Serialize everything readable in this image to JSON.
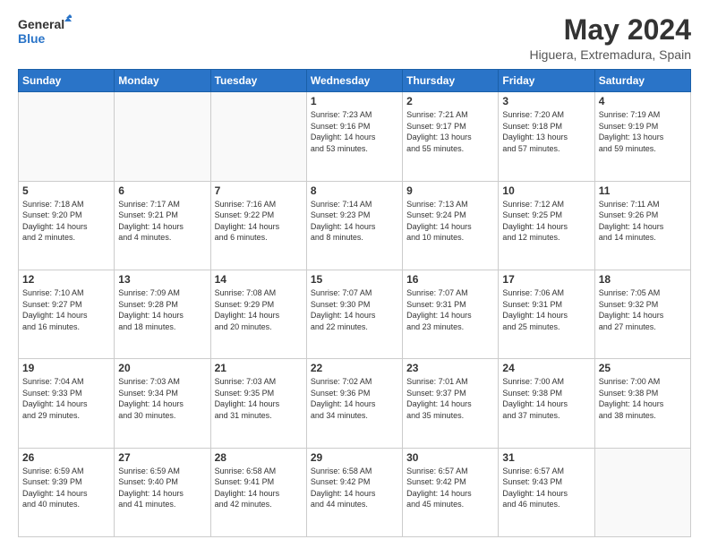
{
  "logo": {
    "line1": "General",
    "line2": "Blue"
  },
  "title": "May 2024",
  "subtitle": "Higuera, Extremadura, Spain",
  "days_of_week": [
    "Sunday",
    "Monday",
    "Tuesday",
    "Wednesday",
    "Thursday",
    "Friday",
    "Saturday"
  ],
  "weeks": [
    [
      {
        "day": "",
        "info": []
      },
      {
        "day": "",
        "info": []
      },
      {
        "day": "",
        "info": []
      },
      {
        "day": "1",
        "info": [
          "Sunrise: 7:23 AM",
          "Sunset: 9:16 PM",
          "Daylight: 14 hours",
          "and 53 minutes."
        ]
      },
      {
        "day": "2",
        "info": [
          "Sunrise: 7:21 AM",
          "Sunset: 9:17 PM",
          "Daylight: 13 hours",
          "and 55 minutes."
        ]
      },
      {
        "day": "3",
        "info": [
          "Sunrise: 7:20 AM",
          "Sunset: 9:18 PM",
          "Daylight: 13 hours",
          "and 57 minutes."
        ]
      },
      {
        "day": "4",
        "info": [
          "Sunrise: 7:19 AM",
          "Sunset: 9:19 PM",
          "Daylight: 13 hours",
          "and 59 minutes."
        ]
      }
    ],
    [
      {
        "day": "5",
        "info": [
          "Sunrise: 7:18 AM",
          "Sunset: 9:20 PM",
          "Daylight: 14 hours",
          "and 2 minutes."
        ]
      },
      {
        "day": "6",
        "info": [
          "Sunrise: 7:17 AM",
          "Sunset: 9:21 PM",
          "Daylight: 14 hours",
          "and 4 minutes."
        ]
      },
      {
        "day": "7",
        "info": [
          "Sunrise: 7:16 AM",
          "Sunset: 9:22 PM",
          "Daylight: 14 hours",
          "and 6 minutes."
        ]
      },
      {
        "day": "8",
        "info": [
          "Sunrise: 7:14 AM",
          "Sunset: 9:23 PM",
          "Daylight: 14 hours",
          "and 8 minutes."
        ]
      },
      {
        "day": "9",
        "info": [
          "Sunrise: 7:13 AM",
          "Sunset: 9:24 PM",
          "Daylight: 14 hours",
          "and 10 minutes."
        ]
      },
      {
        "day": "10",
        "info": [
          "Sunrise: 7:12 AM",
          "Sunset: 9:25 PM",
          "Daylight: 14 hours",
          "and 12 minutes."
        ]
      },
      {
        "day": "11",
        "info": [
          "Sunrise: 7:11 AM",
          "Sunset: 9:26 PM",
          "Daylight: 14 hours",
          "and 14 minutes."
        ]
      }
    ],
    [
      {
        "day": "12",
        "info": [
          "Sunrise: 7:10 AM",
          "Sunset: 9:27 PM",
          "Daylight: 14 hours",
          "and 16 minutes."
        ]
      },
      {
        "day": "13",
        "info": [
          "Sunrise: 7:09 AM",
          "Sunset: 9:28 PM",
          "Daylight: 14 hours",
          "and 18 minutes."
        ]
      },
      {
        "day": "14",
        "info": [
          "Sunrise: 7:08 AM",
          "Sunset: 9:29 PM",
          "Daylight: 14 hours",
          "and 20 minutes."
        ]
      },
      {
        "day": "15",
        "info": [
          "Sunrise: 7:07 AM",
          "Sunset: 9:30 PM",
          "Daylight: 14 hours",
          "and 22 minutes."
        ]
      },
      {
        "day": "16",
        "info": [
          "Sunrise: 7:07 AM",
          "Sunset: 9:31 PM",
          "Daylight: 14 hours",
          "and 23 minutes."
        ]
      },
      {
        "day": "17",
        "info": [
          "Sunrise: 7:06 AM",
          "Sunset: 9:31 PM",
          "Daylight: 14 hours",
          "and 25 minutes."
        ]
      },
      {
        "day": "18",
        "info": [
          "Sunrise: 7:05 AM",
          "Sunset: 9:32 PM",
          "Daylight: 14 hours",
          "and 27 minutes."
        ]
      }
    ],
    [
      {
        "day": "19",
        "info": [
          "Sunrise: 7:04 AM",
          "Sunset: 9:33 PM",
          "Daylight: 14 hours",
          "and 29 minutes."
        ]
      },
      {
        "day": "20",
        "info": [
          "Sunrise: 7:03 AM",
          "Sunset: 9:34 PM",
          "Daylight: 14 hours",
          "and 30 minutes."
        ]
      },
      {
        "day": "21",
        "info": [
          "Sunrise: 7:03 AM",
          "Sunset: 9:35 PM",
          "Daylight: 14 hours",
          "and 31 minutes."
        ]
      },
      {
        "day": "22",
        "info": [
          "Sunrise: 7:02 AM",
          "Sunset: 9:36 PM",
          "Daylight: 14 hours",
          "and 34 minutes."
        ]
      },
      {
        "day": "23",
        "info": [
          "Sunrise: 7:01 AM",
          "Sunset: 9:37 PM",
          "Daylight: 14 hours",
          "and 35 minutes."
        ]
      },
      {
        "day": "24",
        "info": [
          "Sunrise: 7:00 AM",
          "Sunset: 9:38 PM",
          "Daylight: 14 hours",
          "and 37 minutes."
        ]
      },
      {
        "day": "25",
        "info": [
          "Sunrise: 7:00 AM",
          "Sunset: 9:38 PM",
          "Daylight: 14 hours",
          "and 38 minutes."
        ]
      }
    ],
    [
      {
        "day": "26",
        "info": [
          "Sunrise: 6:59 AM",
          "Sunset: 9:39 PM",
          "Daylight: 14 hours",
          "and 40 minutes."
        ]
      },
      {
        "day": "27",
        "info": [
          "Sunrise: 6:59 AM",
          "Sunset: 9:40 PM",
          "Daylight: 14 hours",
          "and 41 minutes."
        ]
      },
      {
        "day": "28",
        "info": [
          "Sunrise: 6:58 AM",
          "Sunset: 9:41 PM",
          "Daylight: 14 hours",
          "and 42 minutes."
        ]
      },
      {
        "day": "29",
        "info": [
          "Sunrise: 6:58 AM",
          "Sunset: 9:42 PM",
          "Daylight: 14 hours",
          "and 44 minutes."
        ]
      },
      {
        "day": "30",
        "info": [
          "Sunrise: 6:57 AM",
          "Sunset: 9:42 PM",
          "Daylight: 14 hours",
          "and 45 minutes."
        ]
      },
      {
        "day": "31",
        "info": [
          "Sunrise: 6:57 AM",
          "Sunset: 9:43 PM",
          "Daylight: 14 hours",
          "and 46 minutes."
        ]
      },
      {
        "day": "",
        "info": []
      }
    ]
  ]
}
